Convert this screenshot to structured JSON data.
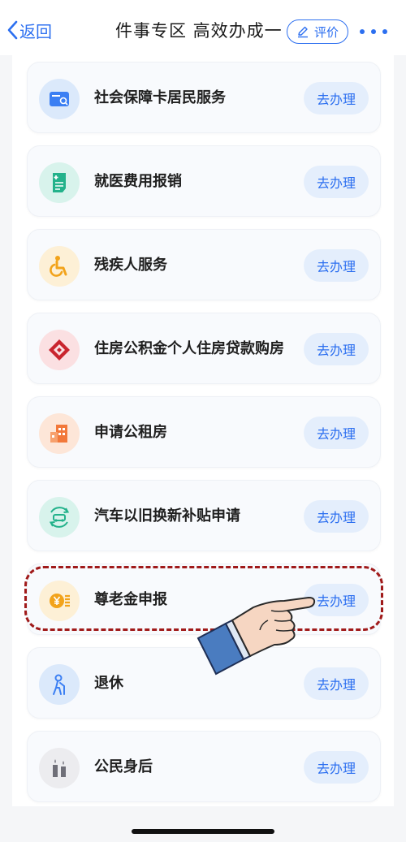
{
  "nav": {
    "back_label": "返回",
    "title": "件事专区  高效办成一",
    "rate_label": "评价"
  },
  "services": [
    {
      "label": "社会保障卡居民服务",
      "action": "去办理",
      "icon": "social-security-card-icon",
      "icon_bg": "#dbe9fb"
    },
    {
      "label": "就医费用报销",
      "action": "去办理",
      "icon": "medical-receipt-icon",
      "icon_bg": "#d8f3ec"
    },
    {
      "label": "残疾人服务",
      "action": "去办理",
      "icon": "wheelchair-icon",
      "icon_bg": "#fdf0d6"
    },
    {
      "label": "住房公积金个人住房贷款购房",
      "action": "去办理",
      "icon": "housing-fund-icon",
      "icon_bg": "#fbe0e2"
    },
    {
      "label": "申请公租房",
      "action": "去办理",
      "icon": "apartment-building-icon",
      "icon_bg": "#fde6d8"
    },
    {
      "label": "汽车以旧换新补贴申请",
      "action": "去办理",
      "icon": "car-recycle-icon",
      "icon_bg": "#d8f3ec"
    },
    {
      "label": "尊老金申报",
      "action": "去办理",
      "icon": "yuan-coin-icon",
      "icon_bg": "#fdf0d6"
    },
    {
      "label": "退休",
      "action": "去办理",
      "icon": "elderly-person-icon",
      "icon_bg": "#dbe9fb"
    },
    {
      "label": "公民身后",
      "action": "去办理",
      "icon": "candles-icon",
      "icon_bg": "#ececef"
    }
  ],
  "colors": {
    "accent": "#2c6ff0",
    "highlight": "#a01a1a"
  }
}
